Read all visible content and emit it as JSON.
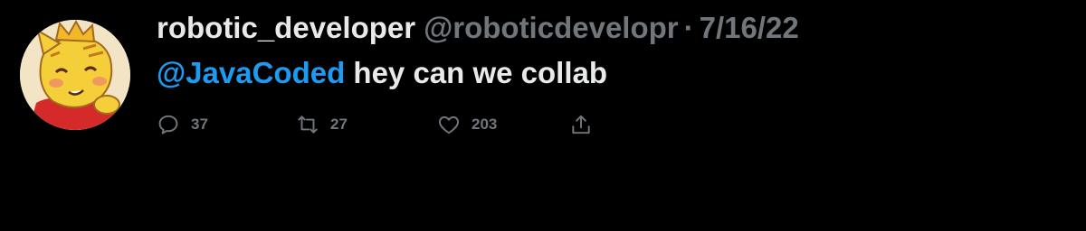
{
  "tweet": {
    "display_name": "robotic_developer",
    "handle": "@roboticdevelopr",
    "separator": "·",
    "date": "7/16/22",
    "mention": "@JavaCoded",
    "text": " hey can we collab",
    "colors": {
      "background": "#000000",
      "primary_text": "#e7e9ea",
      "secondary_text": "#71767b",
      "mention": "#1d9bf0"
    }
  },
  "actions": {
    "reply": {
      "icon": "reply-icon",
      "count": "37"
    },
    "retweet": {
      "icon": "retweet-icon",
      "count": "27"
    },
    "like": {
      "icon": "heart-icon",
      "count": "203"
    },
    "share": {
      "icon": "share-icon"
    }
  }
}
